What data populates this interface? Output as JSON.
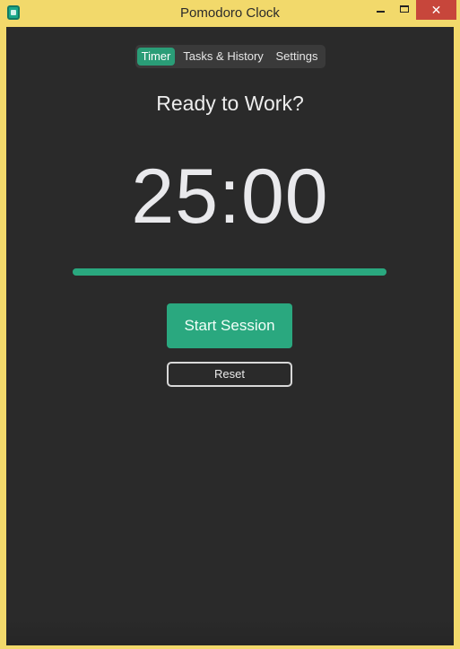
{
  "window": {
    "title": "Pomodoro Clock",
    "controls": {
      "minimize": "",
      "maximize": "",
      "close": "✕"
    }
  },
  "tabs": [
    {
      "label": "Timer",
      "active": true
    },
    {
      "label": "Tasks & History",
      "active": false
    },
    {
      "label": "Settings",
      "active": false
    }
  ],
  "timer": {
    "status": "Ready to Work?",
    "time": "25:00",
    "progress": 1.0
  },
  "actions": {
    "start_label": "Start Session",
    "reset_label": "Reset"
  },
  "colors": {
    "accent": "#2aa87f",
    "background": "#2a2a2a",
    "frame": "#f2d96b",
    "close": "#c7463b"
  }
}
